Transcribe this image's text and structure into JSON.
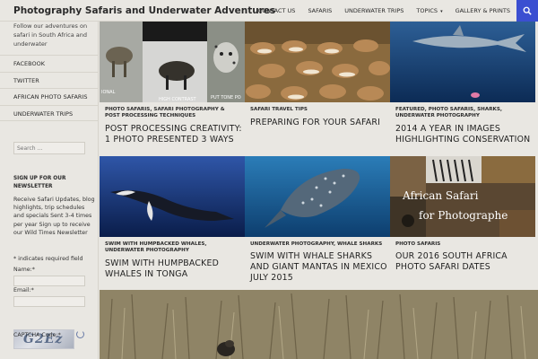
{
  "site": {
    "title": "Photography Safaris and Underwater Adventures",
    "tagline": "Follow our adventures on safari in South Africa and underwater"
  },
  "nav": {
    "items": [
      {
        "label": "CONTACT US"
      },
      {
        "label": "SAFARIS"
      },
      {
        "label": "UNDERWATER TRIPS"
      },
      {
        "label": "TOPICS"
      },
      {
        "label": "GALLERY & PRINTS"
      }
    ],
    "topics_caret": "▾"
  },
  "sidebar": {
    "menu": [
      "FACEBOOK",
      "TWITTER",
      "AFRICAN PHOTO SAFARIS",
      "UNDERWATER TRIPS"
    ],
    "search_placeholder": "Search …",
    "newsletter_title": "SIGN UP FOR OUR NEWSLETTER",
    "newsletter_text": "Receive Safari Updates, blog highlights, trip schedules and specials Sent 3-4 times per year Sign up to receive our Wild Times Newsletter",
    "required_note": "* indicates required field",
    "name_label": "Name:*",
    "email_label": "Email:*",
    "captcha_text": "G2Ez",
    "captcha_label": "CAPTCHA Code:*"
  },
  "posts": [
    {
      "cats": "PHOTO SAFARIS, SAFARI PHOTOGRAPHY & POST PROCESSING TECHNIQUES",
      "title": "POST PROCESSING CREATIVITY: 1 PHOTO PRESENTED 3 WAYS",
      "thumb_labels": [
        "IONAL",
        "HIGH CONTRAST",
        "PUT TONE PO"
      ]
    },
    {
      "cats": "SAFARI TRAVEL TIPS",
      "title": "PREPARING FOR YOUR SAFARI"
    },
    {
      "cats": "FEATURED, PHOTO SAFARIS, SHARKS, UNDERWATER PHOTOGRAPHY",
      "title": "2014 A YEAR IN IMAGES HIGHLIGHTING CONSERVATION"
    },
    {
      "cats": "SWIM WITH HUMPBACKED WHALES, UNDERWATER PHOTOGRAPHY",
      "title": "SWIM WITH HUMPBACKED WHALES IN TONGA"
    },
    {
      "cats": "UNDERWATER PHOTOGRAPHY, WHALE SHARKS",
      "title": "SWIM WITH WHALE SHARKS AND GIANT MANTAS IN MEXICO JULY 2015"
    },
    {
      "cats": "PHOTO SAFARIS",
      "title": "OUR 2016 SOUTH AFRICA PHOTO SAFARI DATES",
      "thumb_labels": [
        "African Safari",
        "for Photographe"
      ]
    }
  ],
  "colors": {
    "accent": "#3b4fd1",
    "background": "#e9e7e2"
  }
}
